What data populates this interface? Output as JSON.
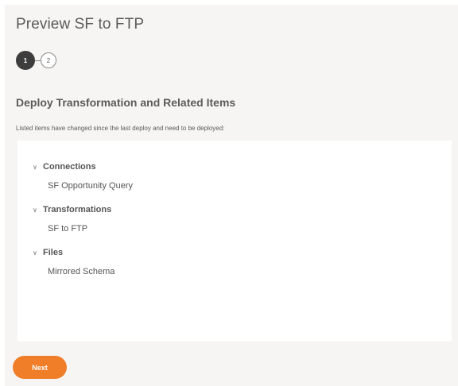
{
  "header": {
    "title": "Preview SF to FTP"
  },
  "stepper": {
    "steps": [
      {
        "label": "1",
        "active": true
      },
      {
        "label": "2",
        "active": false
      }
    ]
  },
  "section": {
    "heading": "Deploy Transformation and Related Items",
    "note": "Listed items have changed since the last deploy and need to be deployed:"
  },
  "groups": [
    {
      "label": "Connections",
      "items": [
        "SF Opportunity Query"
      ]
    },
    {
      "label": "Transformations",
      "items": [
        "SF to FTP"
      ]
    },
    {
      "label": "Files",
      "items": [
        "Mirrored Schema"
      ]
    }
  ],
  "icons": {
    "group_toggle": "chevron-down-icon"
  },
  "footer": {
    "next_label": "Next"
  },
  "colors": {
    "accent": "#f07d28",
    "active_step": "#3d3d3d",
    "panel_background": "#f6f5f3"
  }
}
